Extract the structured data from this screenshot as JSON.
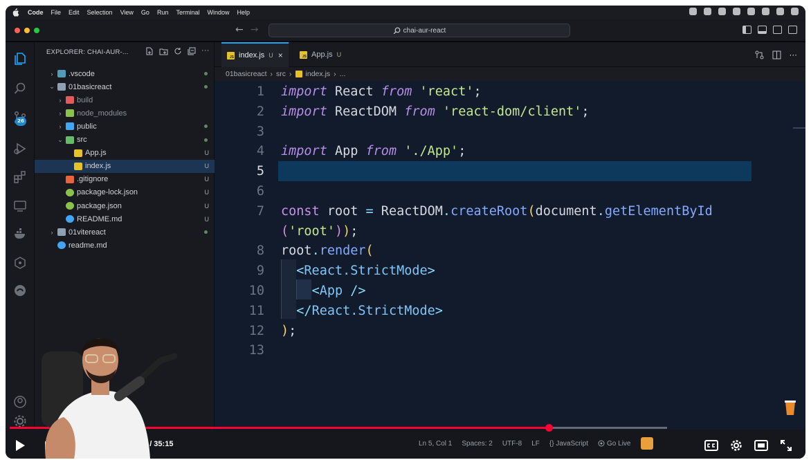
{
  "menubar": {
    "items": [
      "Code",
      "File",
      "Edit",
      "Selection",
      "View",
      "Go",
      "Run",
      "Terminal",
      "Window",
      "Help"
    ]
  },
  "titlebar": {
    "search": "chai-aur-react"
  },
  "activity": {
    "badge": "26"
  },
  "explorer": {
    "title": "EXPLORER: CHAI-AUR-...",
    "items": [
      {
        "label": ".vscode",
        "kind": "folder",
        "depth": 0,
        "chev": "›",
        "status": "dot",
        "color": "#519aba"
      },
      {
        "label": "01basicreact",
        "kind": "folder",
        "depth": 0,
        "chev": "⌄",
        "status": "dot",
        "color": "#8fa0b0"
      },
      {
        "label": "build",
        "kind": "folder",
        "depth": 1,
        "chev": "›",
        "status": "",
        "color": "#e05b5b"
      },
      {
        "label": "node_modules",
        "kind": "folder",
        "depth": 1,
        "chev": "›",
        "status": "",
        "color": "#8bc34a"
      },
      {
        "label": "public",
        "kind": "folder",
        "depth": 1,
        "chev": "›",
        "status": "dot",
        "color": "#42a5f5"
      },
      {
        "label": "src",
        "kind": "folder",
        "depth": 1,
        "chev": "⌄",
        "status": "dot",
        "color": "#66bb6a"
      },
      {
        "label": "App.js",
        "kind": "js",
        "depth": 2,
        "chev": "",
        "status": "U",
        "color": "#e6c229"
      },
      {
        "label": "index.js",
        "kind": "js",
        "depth": 2,
        "chev": "",
        "status": "U",
        "color": "#e6c229",
        "selected": true
      },
      {
        "label": ".gitignore",
        "kind": "git",
        "depth": 1,
        "chev": "",
        "status": "U",
        "color": "#e8643c"
      },
      {
        "label": "package-lock.json",
        "kind": "npm",
        "depth": 1,
        "chev": "",
        "status": "U",
        "color": "#8bc34a"
      },
      {
        "label": "package.json",
        "kind": "npm",
        "depth": 1,
        "chev": "",
        "status": "U",
        "color": "#8bc34a"
      },
      {
        "label": "README.md",
        "kind": "info",
        "depth": 1,
        "chev": "",
        "status": "U",
        "color": "#42a5f5"
      },
      {
        "label": "01vitereact",
        "kind": "folder",
        "depth": 0,
        "chev": "›",
        "status": "dot",
        "color": "#8fa0b0"
      },
      {
        "label": "readme.md",
        "kind": "info",
        "depth": 0,
        "chev": "",
        "status": "",
        "color": "#42a5f5"
      }
    ]
  },
  "tabs": [
    {
      "label": "index.js",
      "flag": "U",
      "close": "×"
    },
    {
      "label": "App.js",
      "flag": "U"
    }
  ],
  "breadcrumb": {
    "parts": [
      "01basicreact",
      "src",
      "index.js",
      "..."
    ]
  },
  "editor": {
    "current_line": 5,
    "lines": [
      {
        "n": "1",
        "tokens": [
          [
            "kw",
            "import"
          ],
          [
            "id",
            " React "
          ],
          [
            "kw",
            "from"
          ],
          [
            "id",
            " "
          ],
          [
            "str",
            "'react'"
          ],
          [
            "id",
            ";"
          ]
        ]
      },
      {
        "n": "2",
        "tokens": [
          [
            "kw",
            "import"
          ],
          [
            "id",
            " ReactDOM "
          ],
          [
            "kw",
            "from"
          ],
          [
            "id",
            " "
          ],
          [
            "str",
            "'react-dom/client'"
          ],
          [
            "id",
            ";"
          ]
        ]
      },
      {
        "n": "3",
        "tokens": []
      },
      {
        "n": "4",
        "tokens": [
          [
            "kw",
            "import"
          ],
          [
            "id",
            " App "
          ],
          [
            "kw",
            "from"
          ],
          [
            "id",
            " "
          ],
          [
            "str",
            "'./App'"
          ],
          [
            "id",
            ";"
          ]
        ]
      },
      {
        "n": "5",
        "tokens": []
      },
      {
        "n": "6",
        "tokens": []
      },
      {
        "n": "7",
        "tokens": [
          [
            "kw2",
            "const"
          ],
          [
            "id",
            " root "
          ],
          [
            "punc",
            "="
          ],
          [
            "id",
            " ReactDOM"
          ],
          [
            "punc",
            "."
          ],
          [
            "fn",
            "createRoot"
          ],
          [
            "paren",
            "("
          ],
          [
            "id",
            "document"
          ],
          [
            "punc",
            "."
          ],
          [
            "fn",
            "getElementById"
          ]
        ]
      },
      {
        "n": "",
        "tokens": [
          [
            "paren2",
            "("
          ],
          [
            "str",
            "'root'"
          ],
          [
            "paren2",
            ")"
          ],
          [
            "paren",
            ")"
          ],
          [
            "id",
            ";"
          ]
        ]
      },
      {
        "n": "8",
        "tokens": [
          [
            "id",
            "root"
          ],
          [
            "punc",
            "."
          ],
          [
            "fn",
            "render"
          ],
          [
            "paren",
            "("
          ]
        ]
      },
      {
        "n": "9",
        "tokens": [
          [
            "id",
            "  "
          ],
          [
            "tagb",
            "<"
          ],
          [
            "tag",
            "React.StrictMode"
          ],
          [
            "tagb",
            ">"
          ]
        ]
      },
      {
        "n": "10",
        "tokens": [
          [
            "id",
            "    "
          ],
          [
            "tagb",
            "<"
          ],
          [
            "tag",
            "App"
          ],
          [
            "id",
            " "
          ],
          [
            "tagb",
            "/>"
          ]
        ]
      },
      {
        "n": "11",
        "tokens": [
          [
            "id",
            "  "
          ],
          [
            "tagb",
            "</"
          ],
          [
            "tag",
            "React.StrictMode"
          ],
          [
            "tagb",
            ">"
          ]
        ]
      },
      {
        "n": "12",
        "tokens": [
          [
            "paren",
            ")"
          ],
          [
            "id",
            ";"
          ]
        ]
      },
      {
        "n": "13",
        "tokens": []
      }
    ]
  },
  "statusbar": {
    "items": [
      "Ln 5, Col 1",
      "Spaces: 2",
      "UTF-8",
      "LF",
      "{} JavaScript",
      "Go Live"
    ]
  },
  "video": {
    "time": "28:53 / 35:15",
    "progress": 0.8196
  },
  "colors": {
    "accent": "#1ea6ff",
    "progress": "#ff0033",
    "editor_bg": "#121b2c"
  }
}
